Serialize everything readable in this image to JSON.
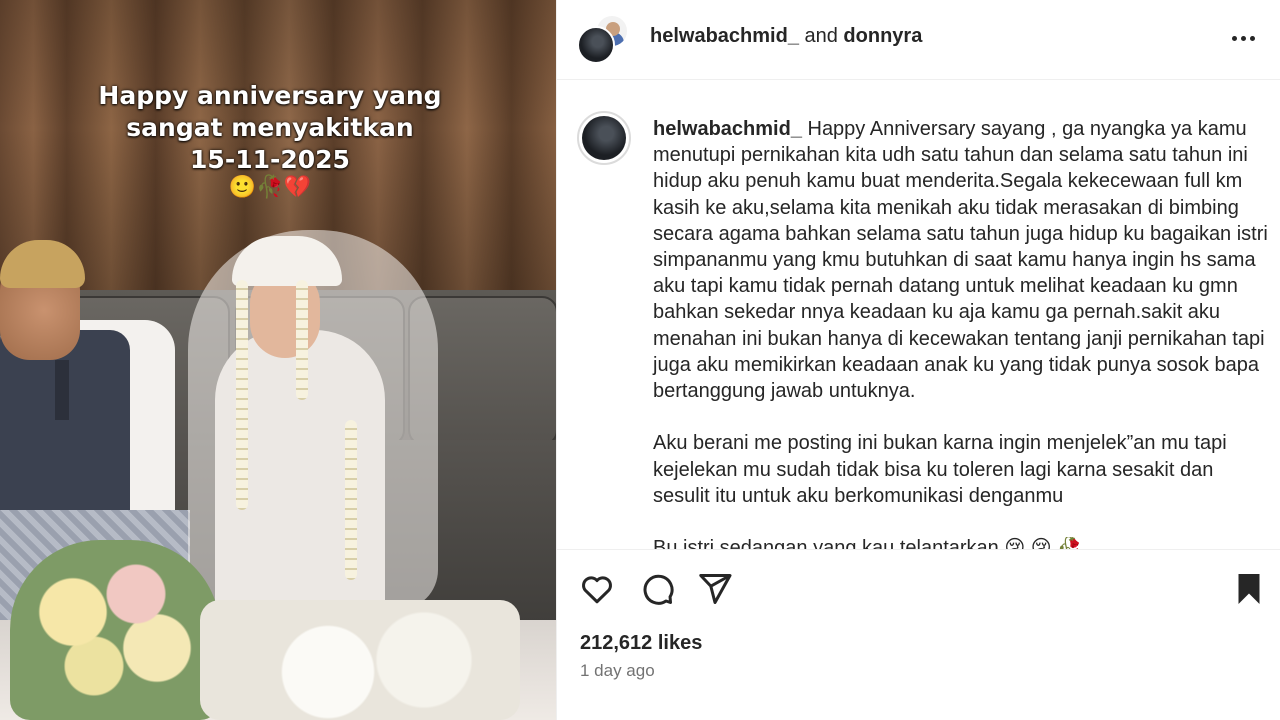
{
  "media": {
    "overlay_line1": "Happy anniversary yang",
    "overlay_line2": "sangat menyakitkan",
    "overlay_line3": "15-11-2025",
    "overlay_emoji": "🙂🥀💔"
  },
  "header": {
    "username1": "helwabachmid_",
    "conjunction": " and ",
    "username2": "donnyra",
    "more_icon": "more-horizontal-icon"
  },
  "caption": {
    "username": "helwabachmid_",
    "text": " Happy Anniversary sayang , ga nyangka ya kamu menutupi pernikahan kita udh satu tahun dan selama satu tahun ini hidup aku penuh kamu buat menderita.Segala kekecewaan full km kasih ke aku,selama kita menikah aku tidak merasakan di bimbing secara agama bahkan selama satu tahun juga hidup ku bagaikan istri simpananmu yang kmu butuhkan di saat kamu hanya ingin hs sama aku tapi kamu tidak pernah datang untuk melihat keadaan ku gmn bahkan sekedar nnya keadaan ku aja kamu ga pernah.sakit aku menahan ini bukan hanya di kecewakan tentang janji pernikahan tapi juga aku memikirkan keadaan anak ku yang tidak punya sosok bapa bertanggung jawab untuknya.\n\nAku berani me posting ini bukan karna ingin menjelek”an mu tapi kejelekan mu sudah tidak bisa ku toleren lagi karna sesakit dan sesulit itu untuk aku berkomunikasi denganmu",
    "cutoff_line": "Bu istri sedangan yang kau telantarkan 😢 😢 🥀"
  },
  "actions": {
    "like_icon": "heart-icon",
    "comment_icon": "comment-icon",
    "share_icon": "send-icon",
    "save_icon": "bookmark-icon"
  },
  "stats": {
    "likes": "212,612 likes",
    "time": "1 day ago"
  },
  "colors": {
    "text": "#262626",
    "secondary": "#737373",
    "divider": "#efefef"
  }
}
